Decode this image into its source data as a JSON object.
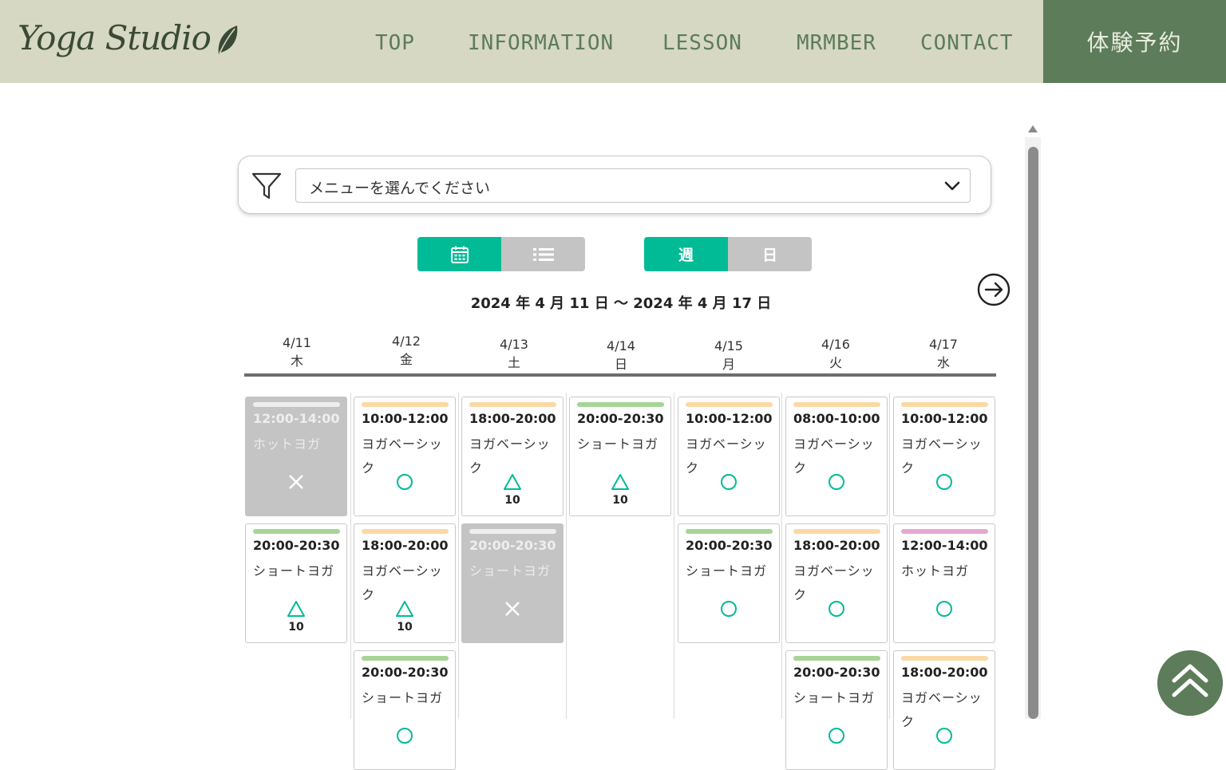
{
  "header": {
    "logo_text": "Yoga Studio",
    "nav": [
      "TOP",
      "INFORMATION",
      "LESSON",
      "MRMBER",
      "CONTACT"
    ],
    "reserve_label": "体験予約"
  },
  "filter": {
    "placeholder": "メニューを選んでください"
  },
  "view_toggle": {
    "calendar": "calendar-icon",
    "list": "list-icon",
    "active": "calendar"
  },
  "range_toggle": {
    "week": "週",
    "day": "日",
    "active": "week"
  },
  "date_range": "2024 年 4 月 11 日 〜 2024 年 4 月 17 日",
  "colors": {
    "accent": "#00bb96",
    "brand": "#5d7c59",
    "basic": "#fbd9a5",
    "short": "#a6d597",
    "hot": "#e6a8d2",
    "full": "#c4c4c4"
  },
  "days": [
    {
      "date": "4/11",
      "weekday": "木",
      "slots": [
        {
          "time": "12:00-14:00",
          "title": "ホットヨガ",
          "status": "full"
        },
        {
          "time": "20:00-20:30",
          "title": "ショートヨガ",
          "status": "few",
          "count": "10"
        }
      ]
    },
    {
      "date": "4/12",
      "weekday": "金",
      "slots": [
        {
          "time": "10:00-12:00",
          "title": "ヨガベーシック",
          "status": "open"
        },
        {
          "time": "18:00-20:00",
          "title": "ヨガベーシック",
          "status": "few",
          "count": "10"
        },
        {
          "time": "20:00-20:30",
          "title": "ショートヨガ",
          "status": "open"
        }
      ]
    },
    {
      "date": "4/13",
      "weekday": "土",
      "slots": [
        {
          "time": "18:00-20:00",
          "title": "ヨガベーシック",
          "status": "few",
          "count": "10"
        },
        {
          "time": "20:00-20:30",
          "title": "ショートヨガ",
          "status": "full"
        }
      ]
    },
    {
      "date": "4/14",
      "weekday": "日",
      "slots": [
        {
          "time": "20:00-20:30",
          "title": "ショートヨガ",
          "status": "few",
          "count": "10"
        }
      ]
    },
    {
      "date": "4/15",
      "weekday": "月",
      "slots": [
        {
          "time": "10:00-12:00",
          "title": "ヨガベーシック",
          "status": "open"
        },
        {
          "time": "20:00-20:30",
          "title": "ショートヨガ",
          "status": "open"
        }
      ]
    },
    {
      "date": "4/16",
      "weekday": "火",
      "slots": [
        {
          "time": "08:00-10:00",
          "title": "ヨガベーシック",
          "status": "open"
        },
        {
          "time": "18:00-20:00",
          "title": "ヨガベーシック",
          "status": "open"
        },
        {
          "time": "20:00-20:30",
          "title": "ショートヨガ",
          "status": "open"
        }
      ]
    },
    {
      "date": "4/17",
      "weekday": "水",
      "slots": [
        {
          "time": "10:00-12:00",
          "title": "ヨガベーシック",
          "status": "open"
        },
        {
          "time": "12:00-14:00",
          "title": "ホットヨガ",
          "status": "open"
        },
        {
          "time": "18:00-20:00",
          "title": "ヨガベーシック",
          "status": "open"
        }
      ]
    }
  ],
  "icons": {
    "back_to_top": "double-chevron-up-icon",
    "next": "arrow-right-circle-icon",
    "filter": "funnel-icon"
  }
}
